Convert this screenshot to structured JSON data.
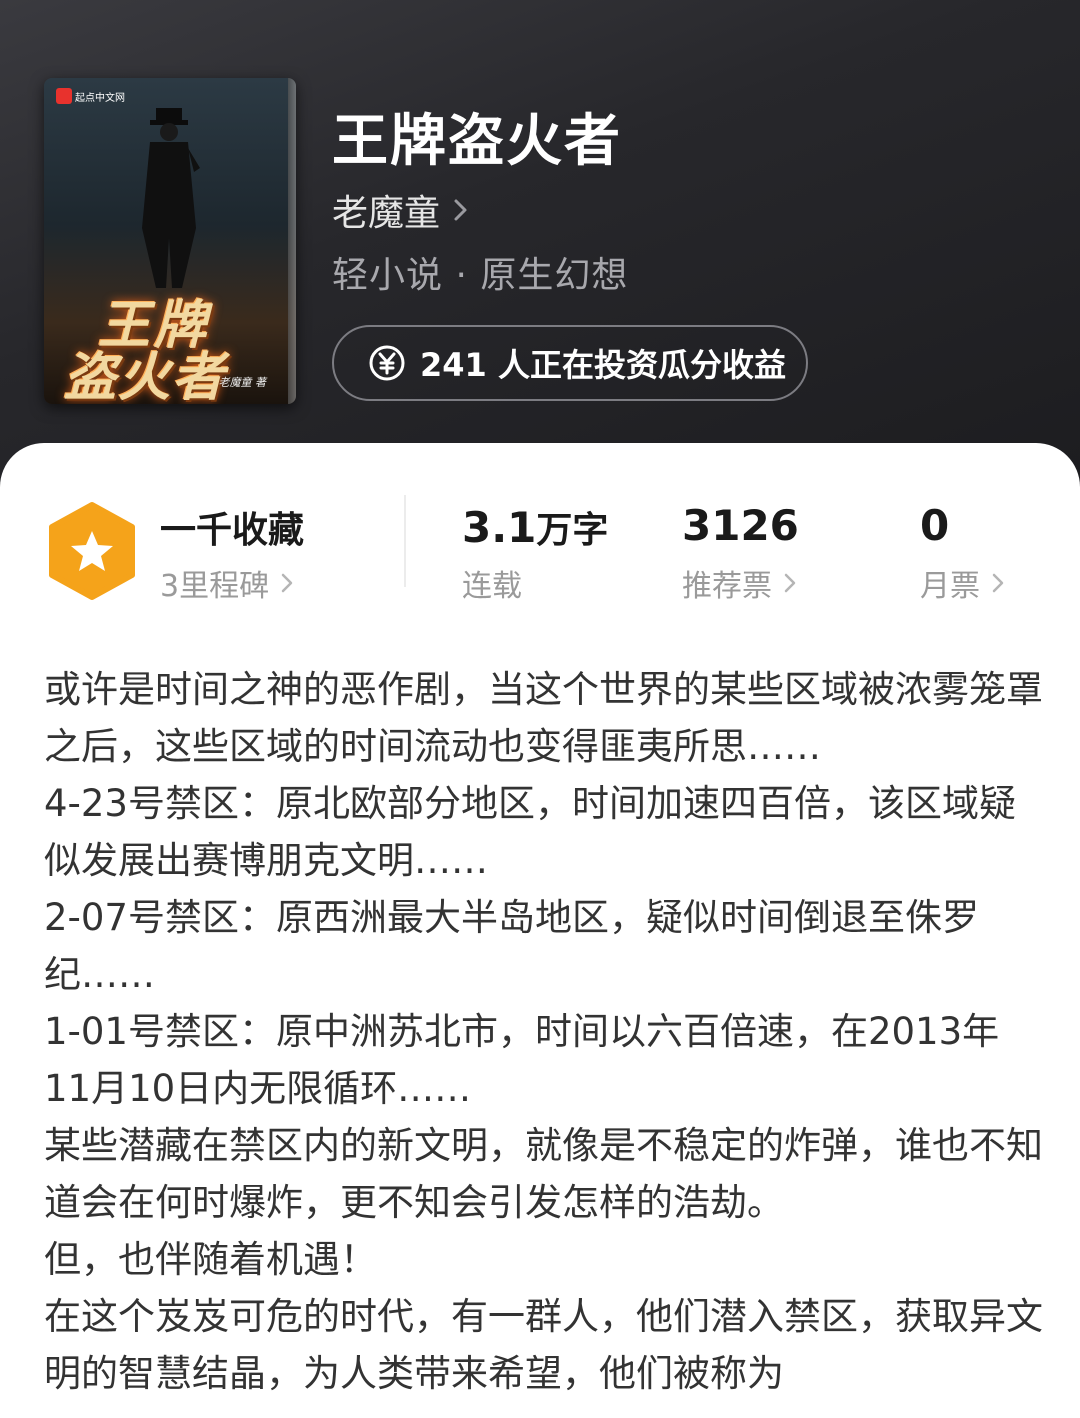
{
  "book": {
    "title": "王牌盗火者",
    "author": "老魔童",
    "genre": "轻小说 · 原生幻想",
    "invest_text": "241 人正在投资瓜分收益",
    "cover": {
      "badge": "起点中文网",
      "art_line1": "王牌",
      "art_line2": "盗火者",
      "author_tag": "老魔童 著"
    }
  },
  "stats": {
    "collection_title": "一千收藏",
    "milestone_label": "3里程碑",
    "word_count_value": "3.1",
    "word_count_unit": "万字",
    "status_label": "连载",
    "recommend_value": "3126",
    "recommend_label": "推荐票",
    "monthly_value": "0",
    "monthly_label": "月票"
  },
  "description": "或许是时间之神的恶作剧，当这个世界的某些区域被浓雾笼罩之后，这些区域的时间流动也变得匪夷所思……\n4-23号禁区：原北欧部分地区，时间加速四百倍，该区域疑似发展出赛博朋克文明……\n2-07号禁区：原西洲最大半岛地区，疑似时间倒退至侏罗纪……\n1-01号禁区：原中洲苏北市，时间以六百倍速，在2013年11月10日内无限循环……\n某些潜藏在禁区内的新文明，就像是不稳定的炸弹，谁也不知道会在何时爆炸，更不知会引发怎样的浩劫。\n但，也伴随着机遇！\n在这个岌岌可危的时代，有一群人，他们潜入禁区，获取异文明的智慧结晶，为人类带来希望，他们被称为",
  "colors": {
    "hero_bg": "#27272b",
    "accent_orange": "#f5a31a"
  }
}
